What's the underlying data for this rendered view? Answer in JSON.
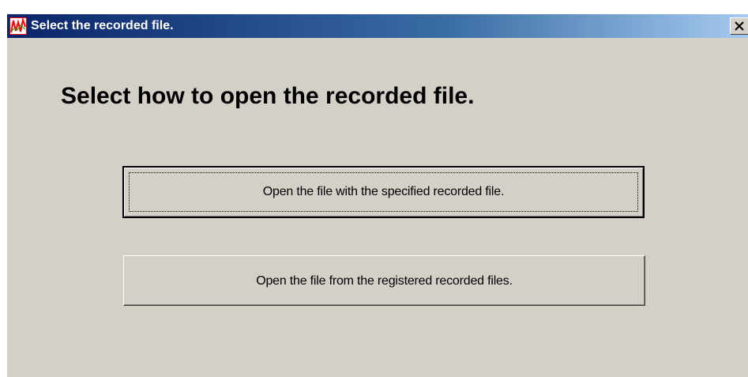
{
  "window": {
    "title": "Select the recorded file.",
    "icon": "app-graph-icon",
    "close_icon": "close-icon"
  },
  "dialog": {
    "heading": "Select how to open the recorded file.",
    "buttons": [
      {
        "label": "Open the file with the specified recorded file.",
        "is_default": true
      },
      {
        "label": "Open the file from the registered recorded files.",
        "is_default": false
      }
    ]
  },
  "colors": {
    "face": "#d4d0c8",
    "title_start": "#0a246a",
    "title_end": "#a6caf0",
    "icon_bg": "#ffffff",
    "icon_line": "#ff0000"
  }
}
